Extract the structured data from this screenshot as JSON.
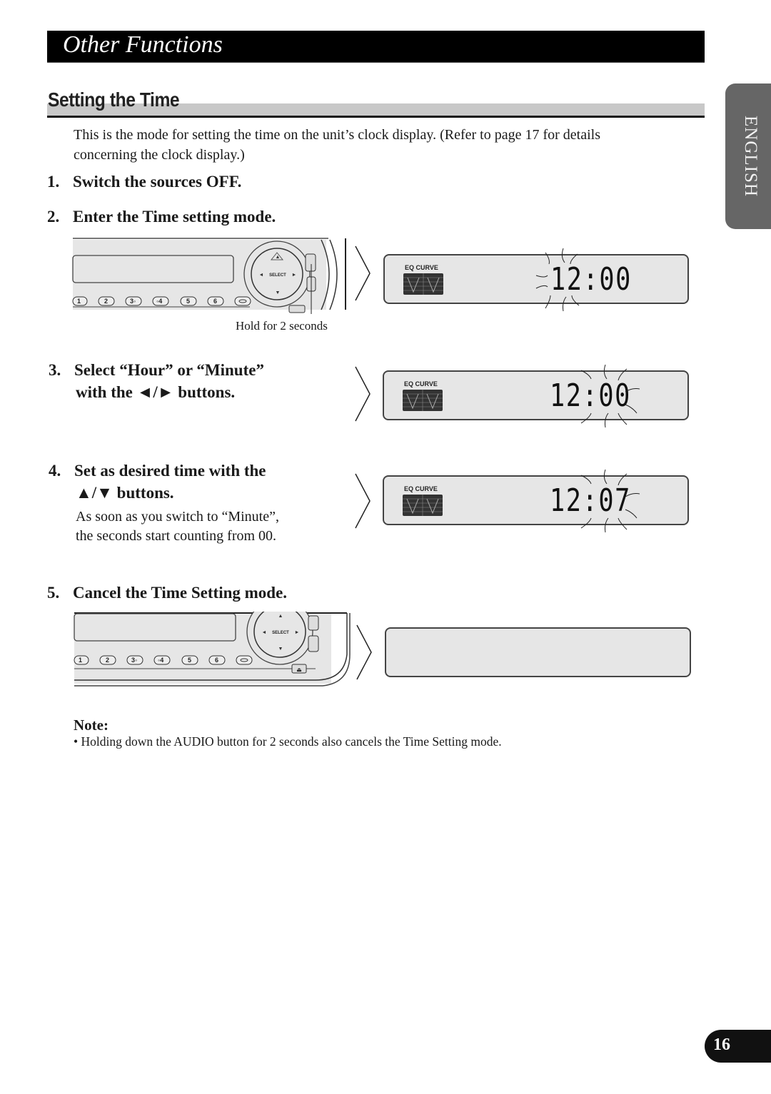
{
  "chapter": {
    "title": "Other Functions"
  },
  "section": {
    "title": "Setting the Time"
  },
  "language_tab": {
    "label": "ENGLISH"
  },
  "intro": "This is the mode for setting the time on the unit’s clock display. (Refer to page 17 for details concerning the clock display.)",
  "steps": [
    {
      "number": "1.",
      "title": "Switch the sources OFF."
    },
    {
      "number": "2.",
      "title": "Enter the Time setting mode.",
      "caption": "Hold for 2 seconds"
    },
    {
      "number": "3.",
      "title_line1": "Select “Hour” or “Minute”",
      "title_line2": "with the ◄/► buttons."
    },
    {
      "number": "4.",
      "title_line1": "Set as desired time with the",
      "title_line2": "▲/▼ buttons.",
      "body_line1": "As soon as you switch to “Minute”,",
      "body_line2": "the seconds start counting from 00."
    },
    {
      "number": "5.",
      "title": "Cancel the Time Setting mode."
    }
  ],
  "displays": [
    {
      "label": "EQ CURVE",
      "time": "12:00",
      "flashing": "hour"
    },
    {
      "label": "EQ CURVE",
      "time": "12:00",
      "flashing": "minute"
    },
    {
      "label": "EQ CURVE",
      "time": "12:07",
      "flashing": "minute"
    },
    {
      "label": "",
      "time": "",
      "flashing": "none"
    }
  ],
  "device": {
    "select_label": "SELECT",
    "preset_buttons": [
      "1",
      "2",
      "3◦",
      "◦4",
      "5",
      "6",
      ""
    ]
  },
  "note": {
    "title": "Note:",
    "bullet": "•  Holding down the AUDIO button for 2 seconds also cancels the Time Setting mode."
  },
  "page_number": "16"
}
